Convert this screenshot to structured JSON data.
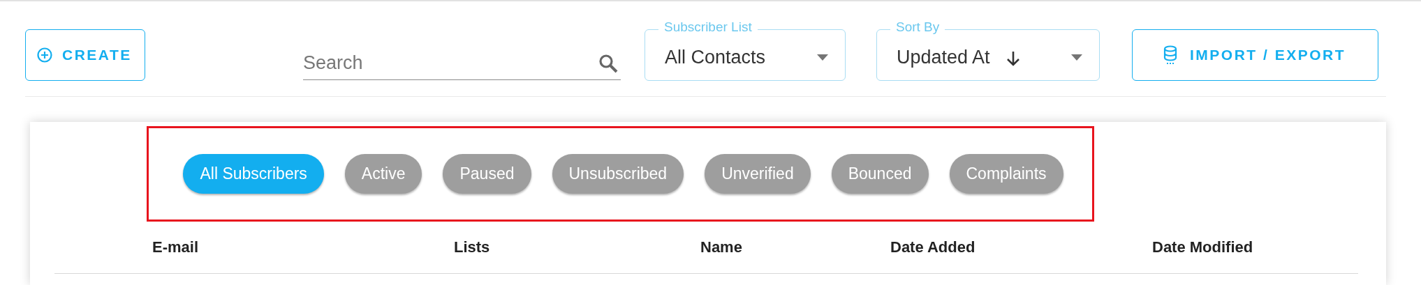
{
  "toolbar": {
    "create_button": {
      "label": "CREATE"
    },
    "search": {
      "placeholder": "Search"
    },
    "subscriber_list": {
      "label": "Subscriber List",
      "value": "All Contacts"
    },
    "sort_by": {
      "label": "Sort By",
      "value": "Updated At",
      "descending": true
    },
    "import_export_button": {
      "label": "IMPORT / EXPORT"
    }
  },
  "filters": [
    {
      "label": "All Subscribers",
      "selected": true
    },
    {
      "label": "Active",
      "selected": false
    },
    {
      "label": "Paused",
      "selected": false
    },
    {
      "label": "Unsubscribed",
      "selected": false
    },
    {
      "label": "Unverified",
      "selected": false
    },
    {
      "label": "Bounced",
      "selected": false
    },
    {
      "label": "Complaints",
      "selected": false
    }
  ],
  "table": {
    "columns": [
      "E-mail",
      "Lists",
      "Name",
      "Date Added",
      "Date Modified"
    ]
  }
}
